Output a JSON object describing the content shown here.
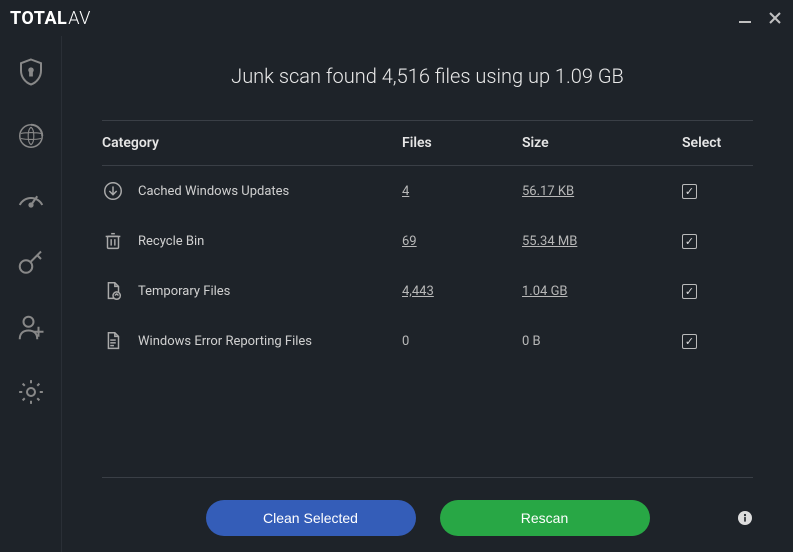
{
  "titlebar": {
    "logo_bold": "TOTAL",
    "logo_thin": "AV"
  },
  "page": {
    "title": "Junk scan found 4,516 files using up 1.09 GB"
  },
  "table": {
    "headers": {
      "category": "Category",
      "files": "Files",
      "size": "Size",
      "select": "Select"
    },
    "rows": [
      {
        "icon": "download-circle-icon",
        "label": "Cached Windows Updates",
        "files": "4",
        "size": "56.17 KB",
        "linked": true
      },
      {
        "icon": "trash-icon",
        "label": "Recycle Bin",
        "files": "69",
        "size": "55.34 MB",
        "linked": true
      },
      {
        "icon": "temp-file-icon",
        "label": "Temporary Files",
        "files": "4,443",
        "size": "1.04 GB",
        "linked": true
      },
      {
        "icon": "error-report-icon",
        "label": "Windows Error Reporting Files",
        "files": "0",
        "size": "0 B",
        "linked": false
      }
    ]
  },
  "footer": {
    "clean_label": "Clean Selected",
    "rescan_label": "Rescan"
  }
}
